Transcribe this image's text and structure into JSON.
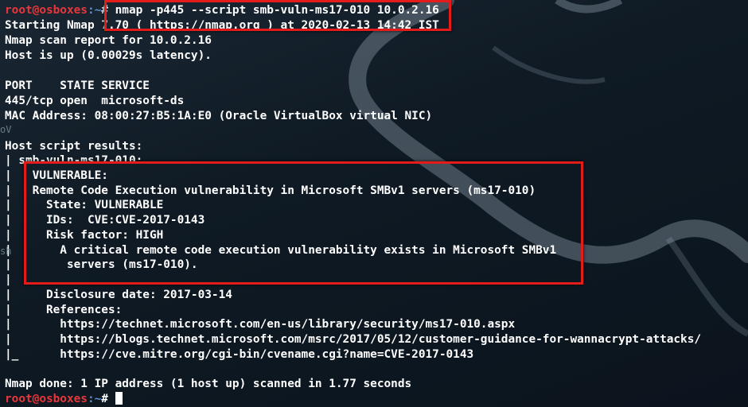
{
  "prompt": {
    "user_host": "root@osboxes",
    "path": ":~",
    "symbol": "# "
  },
  "command": "nmap -p445 --script smb-vuln-ms17-010 10.0.2.16",
  "output_lines": [
    "Starting Nmap 7.70 ( https://nmap.org ) at 2020-02-13 14:42 IST",
    "Nmap scan report for 10.0.2.16",
    "Host is up (0.00029s latency).",
    "",
    "PORT    STATE SERVICE",
    "445/tcp open  microsoft-ds",
    "MAC Address: 08:00:27:B5:1A:E0 (Oracle VirtualBox virtual NIC)",
    "",
    "Host script results:",
    "| smb-vuln-ms17-010:",
    "|   VULNERABLE:",
    "|   Remote Code Execution vulnerability in Microsoft SMBv1 servers (ms17-010)",
    "|     State: VULNERABLE",
    "|     IDs:  CVE:CVE-2017-0143",
    "|     Risk factor: HIGH",
    "|       A critical remote code execution vulnerability exists in Microsoft SMBv1",
    "|        servers (ms17-010).",
    "|",
    "|     Disclosure date: 2017-03-14",
    "|     References:",
    "|       https://technet.microsoft.com/en-us/library/security/ms17-010.aspx",
    "|       https://blogs.technet.microsoft.com/msrc/2017/05/12/customer-guidance-for-wannacrypt-attacks/",
    "|_      https://cve.mitre.org/cgi-bin/cvename.cgi?name=CVE-2017-0143",
    "",
    "Nmap done: 1 IP address (1 host up) scanned in 1.77 seconds"
  ],
  "side_fragments": [
    "oV",
    "sh"
  ],
  "colors": {
    "background": "#0f1a24",
    "prompt_user": "#e8363a",
    "prompt_path": "#5b8fd8",
    "highlight_box": "#e41b1b",
    "text": "#ffffff"
  }
}
